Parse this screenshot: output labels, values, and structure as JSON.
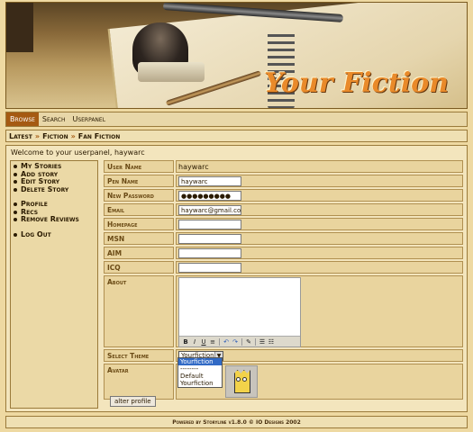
{
  "header": {
    "logo_text": "Your Fiction"
  },
  "nav": {
    "items": [
      "Browse",
      "Search",
      "Userpanel"
    ]
  },
  "breadcrumb": [
    "Latest",
    "Fiction",
    "Fan Fiction"
  ],
  "welcome": "Welcome to your userpanel, haywarc",
  "sidebar": {
    "group1": [
      "My Stories",
      "Add story",
      "Edit Story",
      "Delete Story"
    ],
    "group2": [
      "Profile",
      "Recs",
      "Remove Reviews"
    ],
    "group3": [
      "Log Out"
    ]
  },
  "form": {
    "username": {
      "label": "User Name",
      "value": "haywarc"
    },
    "penname": {
      "label": "Pen Name",
      "value": "haywarc"
    },
    "newpassword": {
      "label": "New Password",
      "value": "●●●●●●●●●"
    },
    "email": {
      "label": "Email",
      "value": "haywarc@gmail.com"
    },
    "homepage": {
      "label": "Homepage",
      "value": ""
    },
    "msn": {
      "label": "MSN",
      "value": ""
    },
    "aim": {
      "label": "AIM",
      "value": ""
    },
    "icq": {
      "label": "ICQ",
      "value": ""
    },
    "about": {
      "label": "About",
      "value": ""
    },
    "theme": {
      "label": "Select Theme",
      "selected": "Yourfiction",
      "options": [
        "Yourfiction",
        "--------",
        "Default",
        "Yourfiction"
      ]
    },
    "avatar": {
      "label": "Avatar"
    }
  },
  "editor_toolbar": [
    "B",
    "I",
    "U",
    "≡",
    "↶",
    "↷",
    "✎",
    "☰",
    "☷"
  ],
  "alter_button": "alter profile",
  "footer": "Powered by Storyline v1.8.0 © IO Designs 2002",
  "colors": {
    "accent": "#a55a12",
    "background": "#eed9a2",
    "logo": "#e98a2a"
  }
}
